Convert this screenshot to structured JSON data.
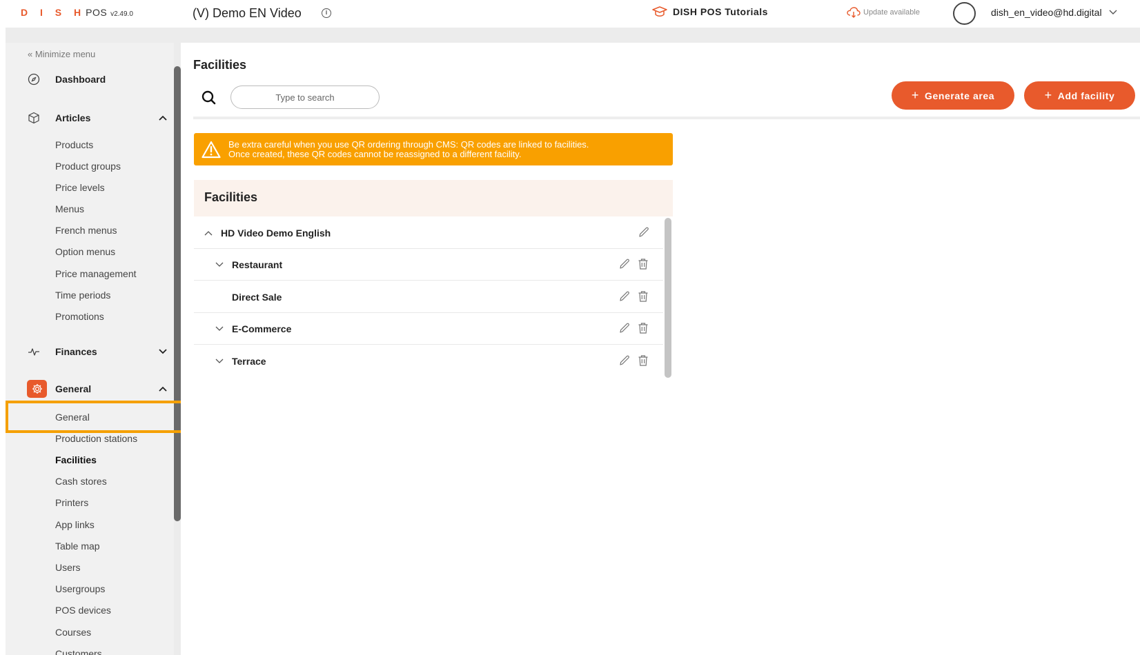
{
  "topbar": {
    "logo_letters": "D I S H",
    "logo_pos": "POS",
    "version": "v2.49.0",
    "account": "(V) Demo EN Video",
    "tutorials": "DISH POS Tutorials",
    "update": "Update available",
    "user": "dish_en_video@hd.digital"
  },
  "sidebar": {
    "minimize": "« Minimize menu",
    "dashboard": "Dashboard",
    "articles": {
      "label": "Articles",
      "items": [
        "Products",
        "Product groups",
        "Price levels",
        "Menus",
        "French menus",
        "Option menus",
        "Price management",
        "Time periods",
        "Promotions"
      ]
    },
    "finances": "Finances",
    "general": {
      "label": "General",
      "items": [
        "General",
        "Production stations",
        "Facilities",
        "Cash stores",
        "Printers",
        "App links",
        "Table map",
        "Users",
        "Usergroups",
        "POS devices",
        "Courses",
        "Customers"
      ]
    }
  },
  "main": {
    "title": "Facilities",
    "search_placeholder": "Type to search",
    "generate_area": "Generate area",
    "add_facility": "Add facility",
    "warning": "Be extra careful when you use QR ordering through CMS: QR codes are linked to facilities. Once created, these QR codes cannot be reassigned to a different facility.",
    "warning_line1": "Be extra careful when you use QR ordering through CMS: QR codes are linked to facilities.",
    "warning_line2": "Once created, these QR codes cannot be reassigned to a different facility.",
    "table_title": "Facilities",
    "rows": [
      {
        "label": "HD Video Demo English",
        "toggle": "up",
        "level": 0,
        "deletable": false
      },
      {
        "label": "Restaurant",
        "toggle": "down",
        "level": 1,
        "deletable": true
      },
      {
        "label": "Direct Sale",
        "toggle": "none",
        "level": 1,
        "deletable": true
      },
      {
        "label": "E-Commerce",
        "toggle": "down",
        "level": 1,
        "deletable": true
      },
      {
        "label": "Terrace",
        "toggle": "down",
        "level": 1,
        "deletable": true
      }
    ]
  },
  "colors": {
    "brand": "#e85a2c",
    "warning": "#f9a000",
    "highlight": "#f5a000"
  }
}
